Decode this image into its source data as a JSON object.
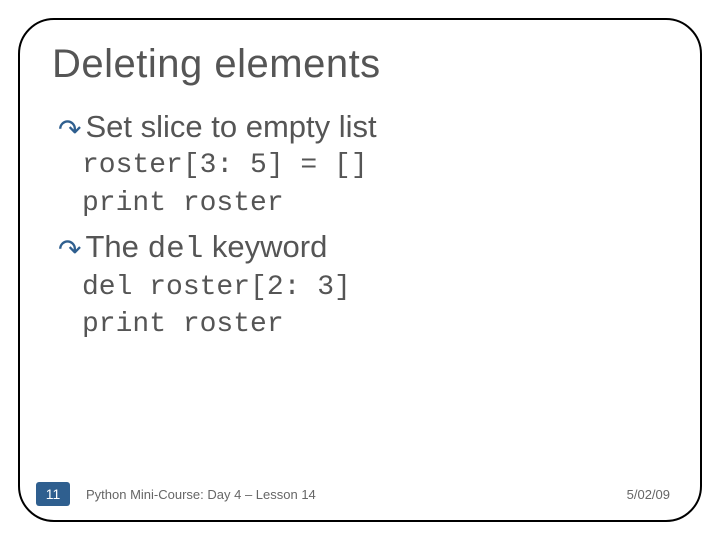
{
  "title": "Deleting elements",
  "bullets": [
    {
      "text": "Set slice to empty list",
      "code": [
        "roster[3: 5] = []",
        "print roster"
      ]
    },
    {
      "prefix": "The ",
      "mono": "del",
      "suffix": " keyword",
      "code": [
        "del roster[2: 3]",
        "print roster"
      ]
    }
  ],
  "footer": {
    "page": "11",
    "text": "Python Mini-Course: Day 4 – Lesson 14",
    "date": "5/02/09"
  }
}
